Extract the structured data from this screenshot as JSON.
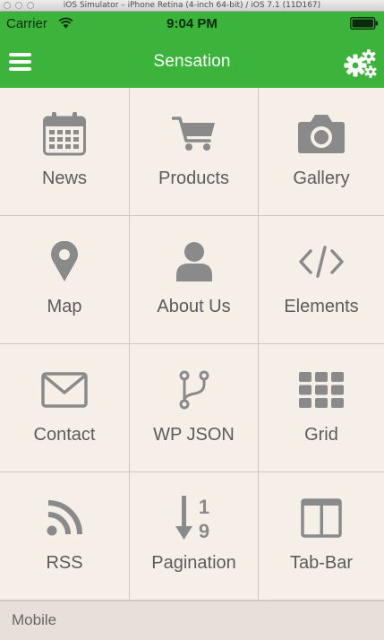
{
  "simulator": {
    "title": "iOS Simulator – iPhone Retina (4-inch 64-bit) / iOS 7.1 (11D167)"
  },
  "status_bar": {
    "carrier": "Carrier",
    "time": "9:04 PM"
  },
  "nav_bar": {
    "title": "Sensation",
    "menu_icon": "hamburger-menu-icon",
    "settings_icon": "gears-icon"
  },
  "menu_grid": [
    {
      "label": "News",
      "icon": "calendar-icon"
    },
    {
      "label": "Products",
      "icon": "shopping-cart-icon"
    },
    {
      "label": "Gallery",
      "icon": "camera-icon"
    },
    {
      "label": "Map",
      "icon": "map-pin-icon"
    },
    {
      "label": "About Us",
      "icon": "user-icon"
    },
    {
      "label": "Elements",
      "icon": "code-icon"
    },
    {
      "label": "Contact",
      "icon": "envelope-icon"
    },
    {
      "label": "WP JSON",
      "icon": "code-fork-icon"
    },
    {
      "label": "Grid",
      "icon": "grid-icon"
    },
    {
      "label": "RSS",
      "icon": "rss-icon"
    },
    {
      "label": "Pagination",
      "icon": "sort-numeric-icon"
    },
    {
      "label": "Tab-Bar",
      "icon": "columns-icon"
    }
  ],
  "footer": {
    "label": "Mobile"
  },
  "colors": {
    "nav_green": "#3cb43b",
    "background": "#f6efe8",
    "icon_gray": "#8a8a8a",
    "label_gray": "#5b5b5b"
  }
}
